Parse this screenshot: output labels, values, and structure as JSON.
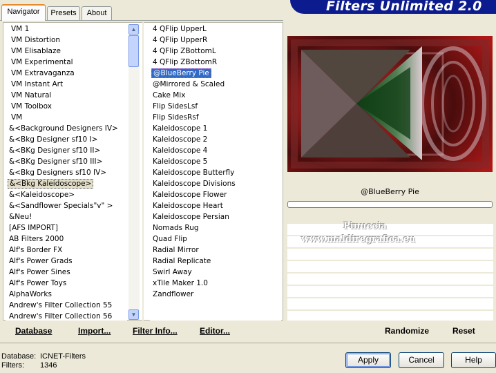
{
  "tabs": [
    {
      "label": "Navigator"
    },
    {
      "label": "Presets"
    },
    {
      "label": "About"
    }
  ],
  "banner_title": "Filters Unlimited 2.0",
  "categories": [
    "VM 1",
    "VM Distortion",
    "VM Elisablaze",
    "VM Experimental",
    "VM Extravaganza",
    "VM Instant Art",
    "VM Natural",
    "VM Toolbox",
    "VM",
    "&<Background Designers IV>",
    "&<Bkg Designer sf10 I>",
    "&<BKg Designer sf10 II>",
    "&<BKg Designer sf10 III>",
    "&<Bkg Designers sf10 IV>",
    "&<Bkg Kaleidoscope>",
    "&<Kaleidoscope>",
    "&<Sandflower Specials\"v\" >",
    "&Neu!",
    "[AFS IMPORT]",
    "AB Filters 2000",
    "Alf's Border FX",
    "Alf's Power Grads",
    "Alf's Power Sines",
    "Alf's Power Toys",
    "AlphaWorks",
    "Andrew's Filter Collection 55",
    "Andrew's Filter Collection 56"
  ],
  "categories_selected_index": 14,
  "filters": [
    "4 QFlip UpperL",
    "4 QFlip UpperR",
    "4 QFlip ZBottomL",
    "4 QFlip ZBottomR",
    "@BlueBerry Pie",
    "@Mirrored & Scaled",
    "Cake Mix",
    "Flip SidesLsf",
    "Flip SidesRsf",
    "Kaleidoscope 1",
    "Kaleidoscope 2",
    "Kaleidoscope 4",
    "Kaleidoscope 5",
    "Kaleidoscope Butterfly",
    "Kaleidoscope Divisions",
    "Kaleidoscope Flower",
    "Kaleidoscope Heart",
    "Kaleidoscope Persian",
    "Nomads Rug",
    "Quad Flip",
    "Radial Mirror",
    "Radial Replicate",
    "Swirl Away",
    "xTile Maker 1.0",
    "Zandflower"
  ],
  "filters_selected_index": 4,
  "preview_filter_name": "@BlueBerry Pie",
  "watermark": {
    "line1": "Pinuccia",
    "line2": "www.maldiregrafica.eu"
  },
  "bottom_links": {
    "database": "Database",
    "import": "Import...",
    "filter_info": "Filter Info...",
    "editor": "Editor...",
    "randomize": "Randomize",
    "reset": "Reset"
  },
  "status": {
    "database_label": "Database:",
    "database_value": "ICNET-Filters",
    "filters_label": "Filters:",
    "filters_value": "1346"
  },
  "buttons": {
    "apply": "Apply",
    "cancel": "Cancel",
    "help": "Help"
  },
  "colors": {
    "banner": "#0c1b8e",
    "selection": "#316ac5",
    "panel": "#ece9d8"
  }
}
